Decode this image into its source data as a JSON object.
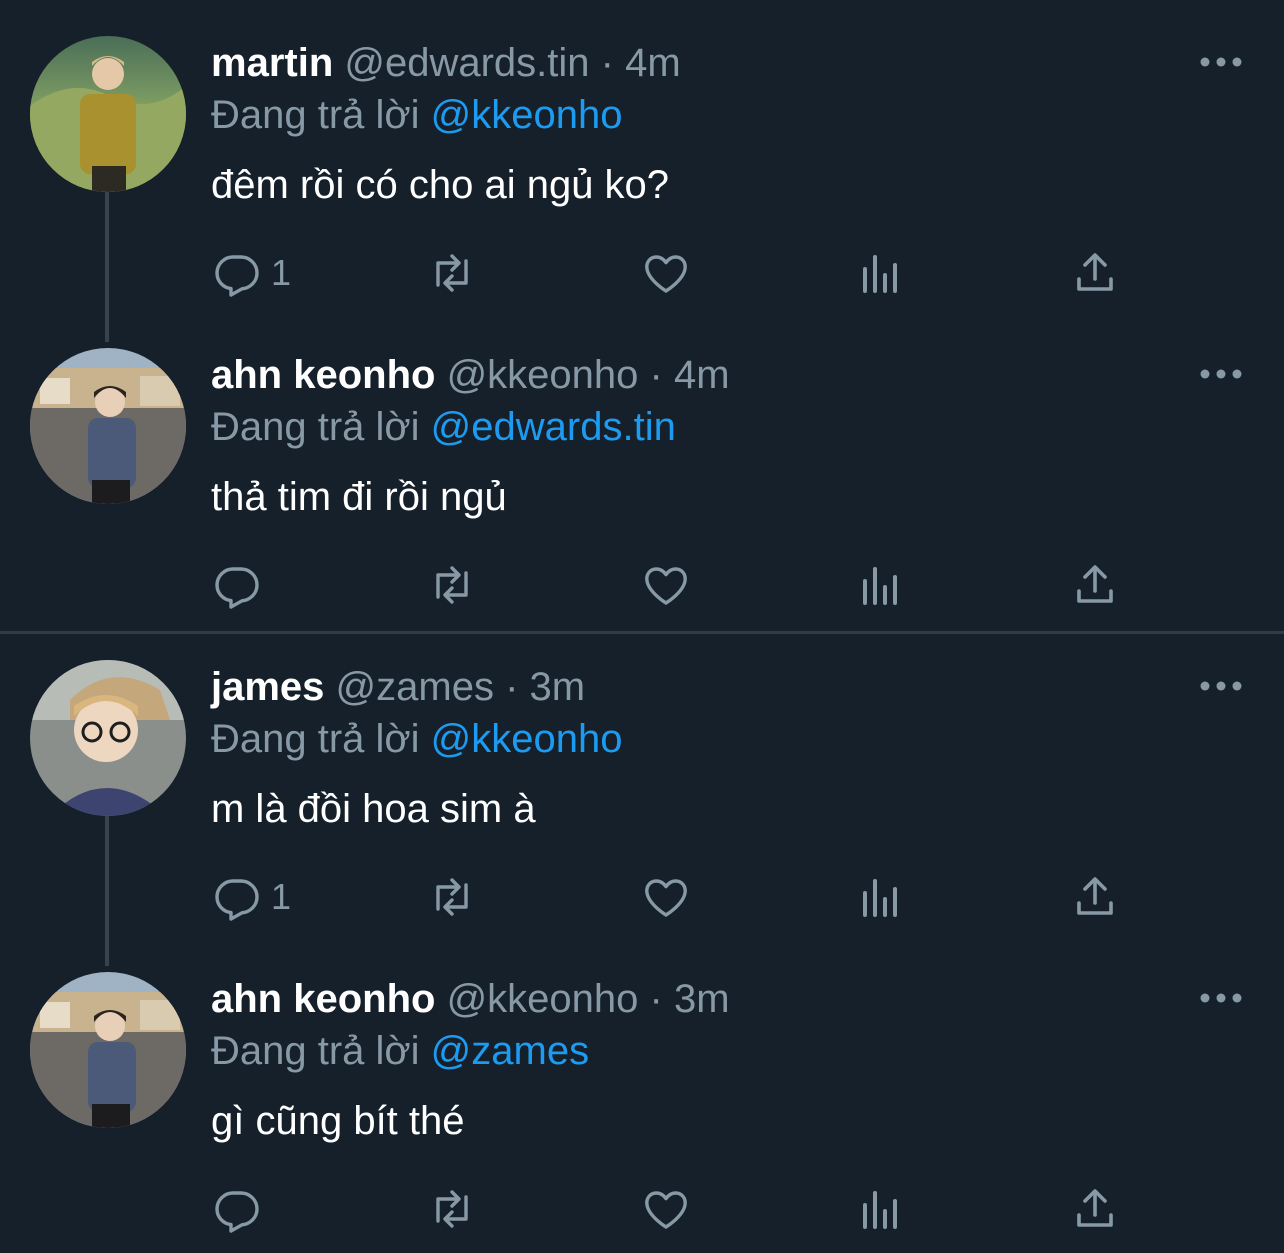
{
  "colors": {
    "background": "#15202b",
    "text_primary": "#ffffff",
    "text_secondary": "#8899a6",
    "mention": "#1d9bf0",
    "thread_line": "#38444d"
  },
  "tweets": [
    {
      "name": "martin",
      "handle": "@edwards.tin",
      "dot": "·",
      "time": "4m",
      "replying_prefix": "Đang trả lời",
      "replying_to": "@kkeonho",
      "text": "đêm rồi có cho ai ngủ ko?",
      "reply_count": "1",
      "avatar_icon": "avatar-photo"
    },
    {
      "name": "ahn keonho",
      "handle": "@kkeonho",
      "dot": "·",
      "time": "4m",
      "replying_prefix": "Đang trả lời",
      "replying_to": "@edwards.tin",
      "text": "thả tim đi rồi ngủ",
      "reply_count": "",
      "avatar_icon": "avatar-photo"
    },
    {
      "name": "james",
      "handle": "@zames",
      "dot": "·",
      "time": "3m",
      "replying_prefix": "Đang trả lời",
      "replying_to": "@kkeonho",
      "text": "m là đồi hoa sim à",
      "reply_count": "1",
      "avatar_icon": "avatar-photo"
    },
    {
      "name": "ahn keonho",
      "handle": "@kkeonho",
      "dot": "·",
      "time": "3m",
      "replying_prefix": "Đang trả lời",
      "replying_to": "@zames",
      "text": "gì cũng bít thé",
      "reply_count": "",
      "avatar_icon": "avatar-photo"
    }
  ],
  "action_icons": [
    "reply-icon",
    "retweet-icon",
    "like-icon",
    "analytics-icon",
    "share-icon"
  ]
}
